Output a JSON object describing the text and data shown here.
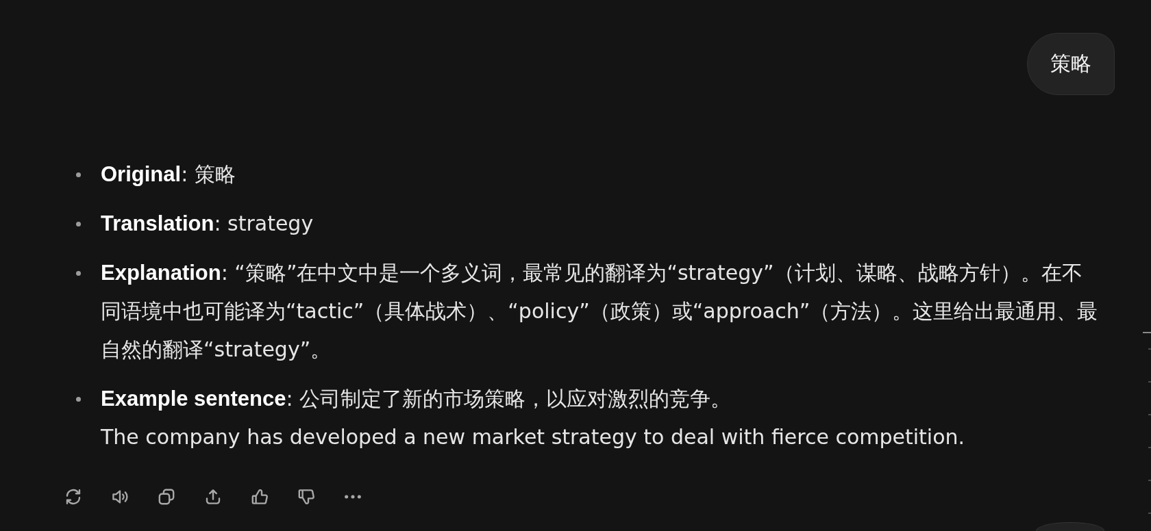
{
  "user_message": {
    "text": "策略"
  },
  "response": {
    "items": [
      {
        "text": "**Original**: 策略"
      },
      {
        "text": "**Translation**: strategy"
      },
      {
        "text": "**Explanation**: “策略”在中文中是一个多义词，最常见的翻译为“strategy”（计划、谋略、战略方针）。在不同语境中也可能译为“tactic”（具体战术）、“policy”（政策）或“approach”（方法）。这里给出最通用、最自然的翻译“strategy”。"
      },
      {
        "text": "**Example sentence**: 公司制定了新的市场策略，以应对激烈的竞争。",
        "continuation": "The company has developed a new market strategy to deal with fierce competition."
      }
    ]
  },
  "nav_markers": [
    {
      "selected": true
    },
    {
      "selected": false
    },
    {
      "selected": false
    },
    {
      "selected": false
    },
    {
      "selected": false
    },
    {
      "selected": false
    },
    {
      "selected": false
    }
  ]
}
